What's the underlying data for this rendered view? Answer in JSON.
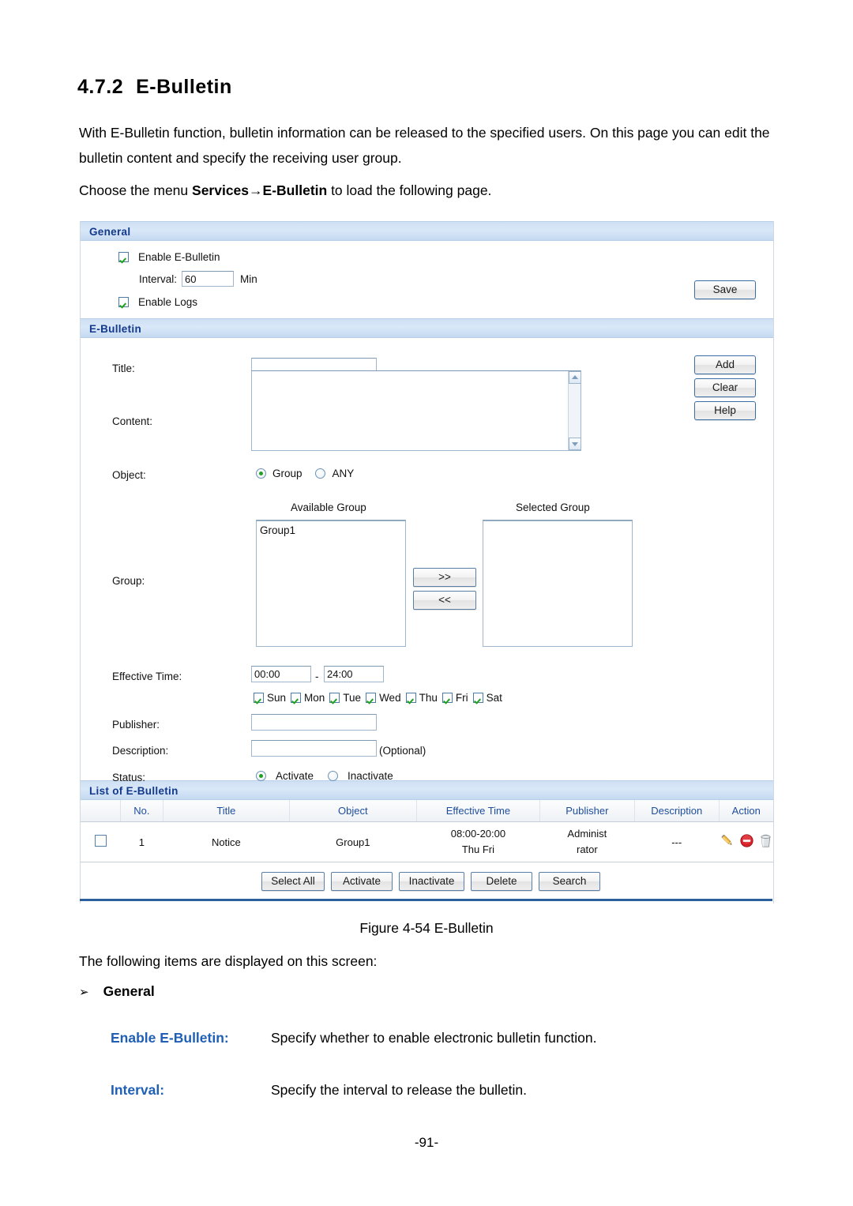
{
  "document": {
    "heading_number": "4.7.2",
    "heading_title": "E-Bulletin",
    "intro_paragraph": "With E-Bulletin function, bulletin information can be released to the specified users. On this page you can edit the bulletin content and specify the receiving user group.",
    "menu_sentence_pre": "Choose the menu ",
    "menu_path_a": "Services",
    "menu_arrow": "→",
    "menu_path_b": "E-Bulletin",
    "menu_sentence_post": " to load the following page.",
    "figure_caption": "Figure 4-54 E-Bulletin",
    "after_figure_text": "The following items are displayed on this screen:",
    "bullet_arrow": "➢",
    "bullet_label": "General",
    "definitions": [
      {
        "term": "Enable E-Bulletin:",
        "desc": "Specify whether to enable electronic bulletin function."
      },
      {
        "term": "Interval:",
        "desc": "Specify the interval to release the bulletin."
      }
    ],
    "page_number": "-91-"
  },
  "ui": {
    "general": {
      "section_title": "General",
      "enable_bulletin_label": "Enable E-Bulletin",
      "enable_bulletin_checked": true,
      "interval_label": "Interval:",
      "interval_value": "60",
      "interval_unit": "Min",
      "enable_logs_label": "Enable Logs",
      "enable_logs_checked": true,
      "save_button": "Save"
    },
    "bulletin": {
      "section_title": "E-Bulletin",
      "title_label": "Title:",
      "title_value": "",
      "content_label": "Content:",
      "content_value": "",
      "object_label": "Object:",
      "object_options": [
        "Group",
        "ANY"
      ],
      "object_selected": "Group",
      "group_label": "Group:",
      "available_group_label": "Available Group",
      "selected_group_label": "Selected Group",
      "available_groups": [
        "Group1"
      ],
      "selected_groups": [],
      "move_right_button": ">>",
      "move_left_button": "<<",
      "effective_time_label": "Effective Time:",
      "effective_time_start": "00:00",
      "effective_time_sep": "-",
      "effective_time_end": "24:00",
      "days": [
        {
          "label": "Sun",
          "checked": true
        },
        {
          "label": "Mon",
          "checked": true
        },
        {
          "label": "Tue",
          "checked": true
        },
        {
          "label": "Wed",
          "checked": true
        },
        {
          "label": "Thu",
          "checked": true
        },
        {
          "label": "Fri",
          "checked": true
        },
        {
          "label": "Sat",
          "checked": true
        }
      ],
      "publisher_label": "Publisher:",
      "publisher_value": "",
      "description_label": "Description:",
      "description_value": "",
      "description_optional": "(Optional)",
      "status_label": "Status:",
      "status_options": [
        "Activate",
        "Inactivate"
      ],
      "status_selected": "Activate",
      "add_button": "Add",
      "clear_button": "Clear",
      "help_button": "Help"
    },
    "list": {
      "section_title": "List of E-Bulletin",
      "columns": [
        "",
        "No.",
        "Title",
        "Object",
        "Effective Time",
        "Publisher",
        "Description",
        "Action"
      ],
      "rows": [
        {
          "selected": false,
          "no": "1",
          "title": "Notice",
          "object": "Group1",
          "effective_time_line1": "08:00-20:00",
          "effective_time_line2": "Thu Fri",
          "publisher_line1": "Administ",
          "publisher_line2": "rator",
          "description": "---",
          "actions": [
            "edit-pencil-icon",
            "deny-circle-icon",
            "trash-bin-icon"
          ]
        }
      ],
      "buttons": [
        "Select All",
        "Activate",
        "Inactivate",
        "Delete",
        "Search"
      ]
    }
  },
  "colors": {
    "section_bar_text": "#12398c",
    "section_bar_bg": "#cfe0f4",
    "table_header_text": "#1f4e9c",
    "accent_rule": "#2c5f9e",
    "term_blue": "#1f5fb5",
    "check_green": "#23a023",
    "deny_red": "#d8232a",
    "pencil_orange": "#f0a21a"
  }
}
